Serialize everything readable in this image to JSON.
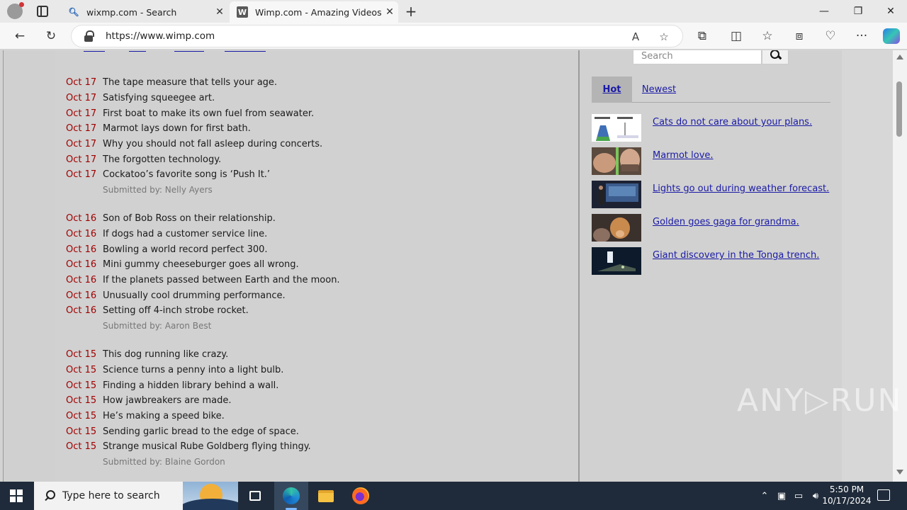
{
  "browser": {
    "tabs": [
      {
        "title": "wixmp.com - Search",
        "favicon": "search-favicon",
        "close": "✕"
      },
      {
        "title": "Wimp.com - Amazing Videos, Fu",
        "favicon": "W",
        "close": "✕"
      }
    ],
    "new_tab": "+",
    "window_controls": {
      "minimize": "—",
      "restore": "❐",
      "close": "✕"
    },
    "address_url": "https://www.wimp.com",
    "toolbar_icons": {
      "back": "←",
      "refresh": "↻",
      "read_aloud": "A",
      "favorite": "☆",
      "extensions": "⧉",
      "split": "◫",
      "favorites": "☆",
      "collections": "⧈",
      "performance": "♡",
      "more": "···"
    }
  },
  "feed": {
    "groups": [
      {
        "items": [
          {
            "date": "Oct 17",
            "headline": "The tape measure that tells your age."
          },
          {
            "date": "Oct 17",
            "headline": "Satisfying squeegee art."
          },
          {
            "date": "Oct 17",
            "headline": "First boat to make its own fuel from seawater."
          },
          {
            "date": "Oct 17",
            "headline": "Marmot lays down for first bath."
          },
          {
            "date": "Oct 17",
            "headline": "Why you should not fall asleep during concerts."
          },
          {
            "date": "Oct 17",
            "headline": "The forgotten technology."
          },
          {
            "date": "Oct 17",
            "headline": "Cockatoo’s favorite song is ‘Push It.’"
          }
        ],
        "submitted": "Submitted by: Nelly Ayers"
      },
      {
        "items": [
          {
            "date": "Oct 16",
            "headline": "Son of Bob Ross on their relationship."
          },
          {
            "date": "Oct 16",
            "headline": "If dogs had a customer service line."
          },
          {
            "date": "Oct 16",
            "headline": "Bowling a world record perfect 300."
          },
          {
            "date": "Oct 16",
            "headline": "Mini gummy cheeseburger goes all wrong."
          },
          {
            "date": "Oct 16",
            "headline": "If the planets passed between Earth and the moon."
          },
          {
            "date": "Oct 16",
            "headline": "Unusually cool drumming performance."
          },
          {
            "date": "Oct 16",
            "headline": "Setting off 4-inch strobe rocket."
          }
        ],
        "submitted": "Submitted by: Aaron Best"
      },
      {
        "items": [
          {
            "date": "Oct 15",
            "headline": "This dog running like crazy."
          },
          {
            "date": "Oct 15",
            "headline": "Science turns a penny into a light bulb."
          },
          {
            "date": "Oct 15",
            "headline": "Finding a hidden library behind a wall."
          },
          {
            "date": "Oct 15",
            "headline": "How jawbreakers are made."
          },
          {
            "date": "Oct 15",
            "headline": "He’s making a speed bike."
          },
          {
            "date": "Oct 15",
            "headline": "Sending garlic bread to the edge of space."
          },
          {
            "date": "Oct 15",
            "headline": "Strange musical Rube Goldberg flying thingy."
          }
        ],
        "submitted": "Submitted by: Blaine Gordon"
      }
    ]
  },
  "sidebar": {
    "search_placeholder": "Search",
    "tabs": {
      "hot": "Hot",
      "newest": "Newest"
    },
    "hot_items": [
      {
        "title": "Cats do not care about your plans.",
        "thumb": "chart-thumb"
      },
      {
        "title": "Marmot love.",
        "thumb": "faces-thumb"
      },
      {
        "title": "Lights go out during weather forecast.",
        "thumb": "studio-thumb"
      },
      {
        "title": "Golden goes gaga for grandma.",
        "thumb": "dog-thumb"
      },
      {
        "title": "Giant discovery in the Tonga trench.",
        "thumb": "deepsea-thumb"
      }
    ]
  },
  "watermark": "ANY▷RUN",
  "taskbar": {
    "search_placeholder": "Type here to search",
    "time": "5:50 PM",
    "date": "10/17/2024"
  },
  "colors": {
    "date_red": "#a00000",
    "link_blue": "#1a1aa6",
    "taskbar": "#1f2b3a"
  }
}
